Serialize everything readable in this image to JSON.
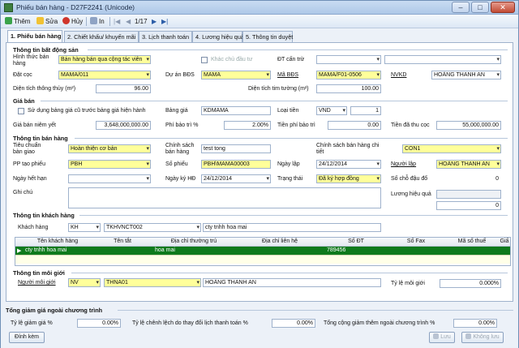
{
  "window": {
    "title": "Phiếu bán hàng - D27F2241 (Unicode)",
    "minimize": "–",
    "maximize": "□",
    "close": "✕"
  },
  "toolbar": {
    "add": "Thêm",
    "edit": "Sửa",
    "cancel": "Hủy",
    "print": "In",
    "first": "|◀",
    "prev": "◀",
    "page": "1/17",
    "next": "▶",
    "last": "▶|"
  },
  "tabs": [
    "1. Phiếu bán hàng",
    "2. Chiết khấu/ khuyến mãi",
    "3. Lịch thanh toán",
    "4. Lương hiệu quả",
    "5. Thông tin duyệt"
  ],
  "property": {
    "title": "Thông tin bất động sản",
    "form_label": "Hình thức bán hàng",
    "form_value": "Bán hàng bán qua cộng tác viên",
    "other_place_label": "Khác chủ đầu tư",
    "dt_label": "ĐT cấn trừ",
    "deposit_label": "Đặt cọc",
    "deposit_value": "MAMA/011",
    "project_label": "Dự án BĐS",
    "project_value": "MAMA",
    "code_label": "Mã BĐS",
    "code_value": "MAMA/F01-0506",
    "nvkd_label": "NVKD",
    "nvkd_value": "HOÀNG THANH AN",
    "area_label": "Diện tích thông thủy (m²)",
    "area_value": "96.00",
    "area2_label": "Diện tích tim tường (m²)",
    "area2_value": "100.00"
  },
  "price": {
    "title": "Giá bán",
    "use_table_label": "Sử dụng bảng giá cũ trước bảng giá hiện hành",
    "table_label": "Bảng giá",
    "table_value": "KDMAMA",
    "currency_label": "Loại tiền",
    "currency_value": "VND",
    "rate_value": "1",
    "list_label": "Giá bán niêm yết",
    "list_value": "3,648,000,000.00",
    "fee_label": "Phí bảo trì %",
    "fee_value": "2.00%",
    "fee_money_label": "Tiền phí bảo trì",
    "fee_money_value": "0.00",
    "collected_label": "Tiền đã thu cọc",
    "collected_value": "55,000,000.00"
  },
  "sale": {
    "title": "Thông tin bán hàng",
    "standard_label": "Tiêu chuẩn bàn giao",
    "standard_value": "Hoàn thiện cơ bản",
    "policy_label": "Chính sách bán hàng",
    "policy_value": "test tong",
    "policy_detail_label": "Chính sách bán hàng chi tiết",
    "policy_detail_value": "CON1",
    "pp_label": "PP tạo phiếu",
    "pp_value": "PBH",
    "voucher_label": "Số phiếu",
    "voucher_value": "PBH\\MAMA00003",
    "date_label": "Ngày lập",
    "date_value": "24/12/2014",
    "creator_label": "Người lập",
    "creator_value": "HOÀNG THANH AN",
    "expiry_label": "Ngày hết hạn",
    "signed_label": "Ngày ký HĐ",
    "signed_value": "24/12/2014",
    "status_label": "Trạng thái",
    "status_value": "Đã ký hợp đồng",
    "swap_label": "Số chỗ đậu đổ",
    "swap_value": "0",
    "note_label": "Ghi chú",
    "wage_label": "Lương hiệu quả",
    "wage_value": "0"
  },
  "customer": {
    "title": "Thông tin khách hàng",
    "label": "Khách hàng",
    "type_value": "KH",
    "id_value": "TKHVNCT002",
    "name_value": "cty tnhh hoa mai",
    "headers": [
      "Tên khách hàng",
      "Tên tắt",
      "Địa chỉ thường trú",
      "Địa chỉ liên hệ",
      "Số ĐT",
      "Số Fax",
      "Mã số thuế",
      "Giấ"
    ],
    "row": [
      "cty tnhh hoa mai",
      "",
      "hoa mai",
      "",
      "789456",
      "",
      "",
      ""
    ],
    "row_marker": "▶"
  },
  "broker": {
    "title": "Thông tin môi giới",
    "label": "Người môi giới",
    "type_value": "NV",
    "id_value": "THNA01",
    "name_value": "HOÀNG THANH AN",
    "rate_label": "Tỷ lệ môi giới",
    "rate_value": "0.000%"
  },
  "discount": {
    "title": "Tổng giảm giá ngoài chương trình",
    "pct_label": "Tỷ lệ giảm giá %",
    "pct_value": "0.00%",
    "diff_label": "Tỷ lệ chênh lệch do thay đổi lịch thanh toán %",
    "diff_value": "0.00%",
    "total_label": "Tổng cộng giảm thêm ngoài chương trình %",
    "total_value": "0.00%"
  },
  "buttons": {
    "attach": "Đính kèm",
    "save": "Lưu",
    "nosave": "Không lưu"
  },
  "colors": {
    "highlight": "#ffff9a",
    "row_selected": "#0e7a1c"
  }
}
